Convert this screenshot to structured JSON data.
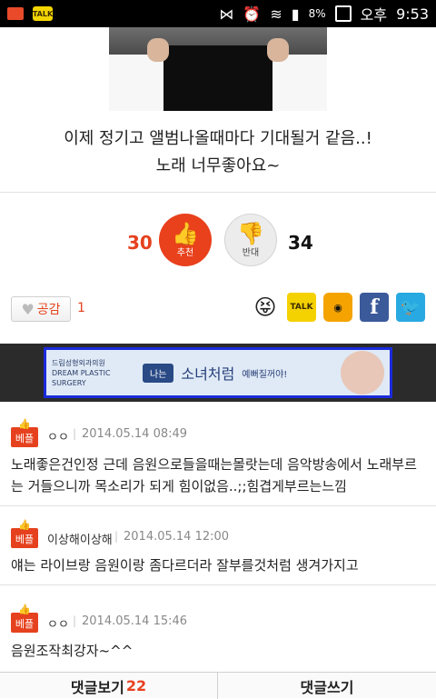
{
  "status_bar": {
    "talk_label": "TALK",
    "battery_pct": "8%",
    "period": "오후",
    "time": "9:53"
  },
  "article": {
    "caption_line1": "이제 정기고 앨범나올때마다 기대될거 같음..!",
    "caption_line2": "노래 너무좋아요~"
  },
  "vote": {
    "up_count": "30",
    "up_label": "추천",
    "down_label": "반대",
    "down_count": "34"
  },
  "share": {
    "like_label": "공감",
    "like_count": "1",
    "talk_label": "TALK",
    "facebook_label": "f"
  },
  "ad": {
    "brand_line1": "드림성형외과의원",
    "brand_line2": "DREAM PLASTIC SURGERY",
    "tag": "나는",
    "headline": "소녀처럼",
    "sub": "예뻐질꺼야!"
  },
  "comments": [
    {
      "badge": "베플",
      "user": "ㅇㅇ",
      "date": "2014.05.14 08:49",
      "text": "노래좋은건인정 근데 음원으로들을때는몰랏는데 음악방송에서 노래부르는 거들으니까 목소리가 되게 힘이없음..;;힘겹게부르는느낌"
    },
    {
      "badge": "베플",
      "user": "이상해이상해",
      "date": "2014.05.14 12:00",
      "text": "얘는 라이브랑 음원이랑 좀다르더라 잘부를것처럼 생겨가지고"
    },
    {
      "badge": "베플",
      "user": "ㅇㅇ",
      "date": "2014.05.14 15:46",
      "text": "음원조작최강자~^^"
    }
  ],
  "bottom": {
    "view_comments_label": "댓글보기",
    "comment_count": "22",
    "write_comment_label": "댓글쓰기"
  }
}
